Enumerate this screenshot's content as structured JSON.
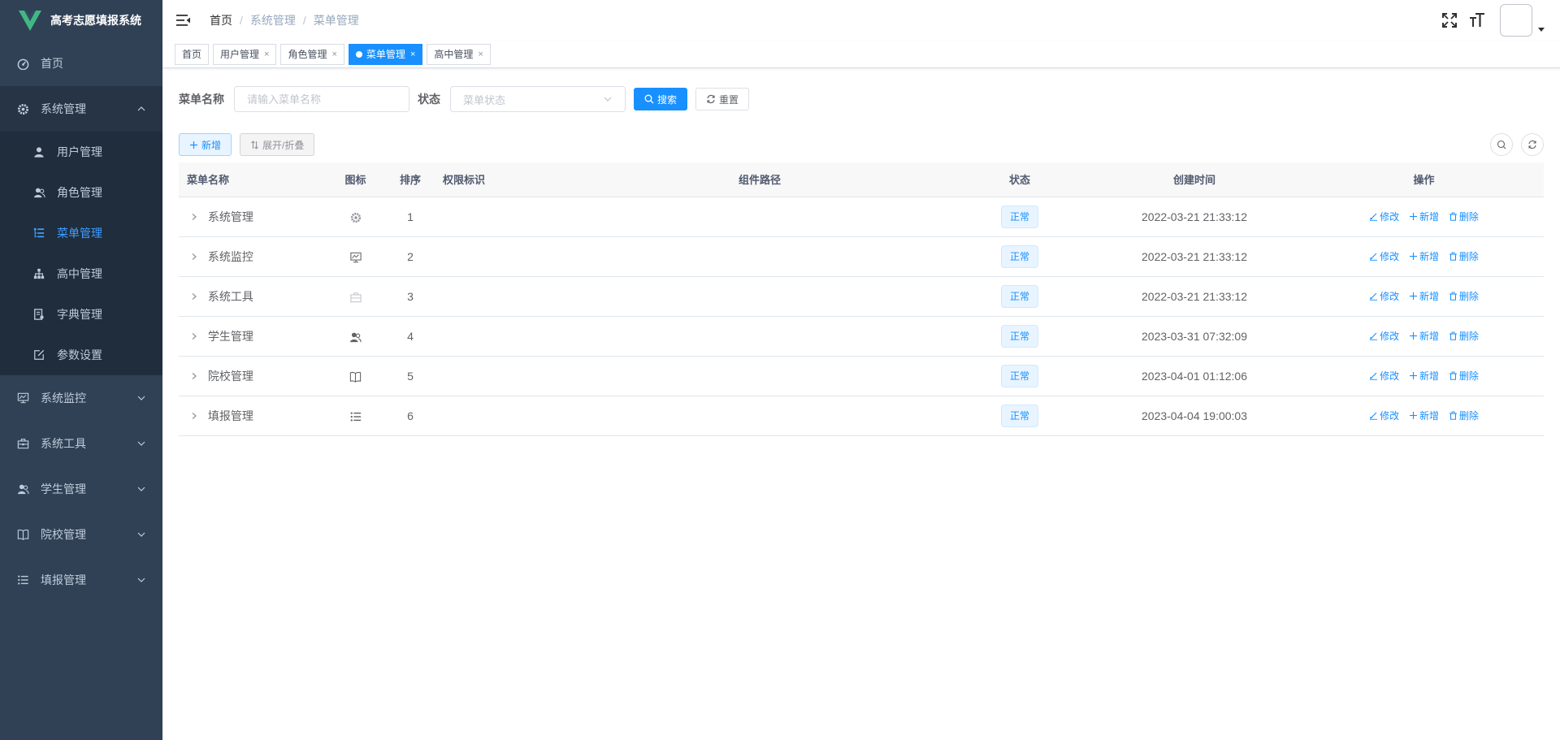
{
  "app": {
    "title": "高考志愿填报系统",
    "brand_color": "#41b883"
  },
  "sidebar": {
    "items": [
      {
        "label": "首页",
        "icon": "dashboard-icon"
      },
      {
        "label": "系统管理",
        "icon": "gear-icon",
        "open": true,
        "children": [
          {
            "label": "用户管理",
            "icon": "user-icon"
          },
          {
            "label": "角色管理",
            "icon": "peoples-icon"
          },
          {
            "label": "菜单管理",
            "icon": "tree-table-icon",
            "active": true
          },
          {
            "label": "高中管理",
            "icon": "tree-icon"
          },
          {
            "label": "字典管理",
            "icon": "dict-icon"
          },
          {
            "label": "参数设置",
            "icon": "edit-icon"
          }
        ]
      },
      {
        "label": "系统监控",
        "icon": "monitor-icon"
      },
      {
        "label": "系统工具",
        "icon": "tool-icon"
      },
      {
        "label": "学生管理",
        "icon": "peoples-icon"
      },
      {
        "label": "院校管理",
        "icon": "book-icon"
      },
      {
        "label": "填报管理",
        "icon": "list-icon"
      }
    ]
  },
  "breadcrumb": [
    "首页",
    "系统管理",
    "菜单管理"
  ],
  "tags": [
    {
      "label": "首页",
      "closable": false
    },
    {
      "label": "用户管理",
      "closable": true
    },
    {
      "label": "角色管理",
      "closable": true
    },
    {
      "label": "菜单管理",
      "closable": true,
      "active": true
    },
    {
      "label": "高中管理",
      "closable": true
    }
  ],
  "search": {
    "name_label": "菜单名称",
    "name_placeholder": "请输入菜单名称",
    "status_label": "状态",
    "status_placeholder": "菜单状态",
    "search_btn": "搜索",
    "reset_btn": "重置"
  },
  "toolbar": {
    "add_btn": "新增",
    "expand_btn": "展开/折叠"
  },
  "table": {
    "columns": [
      "菜单名称",
      "图标",
      "排序",
      "权限标识",
      "组件路径",
      "状态",
      "创建时间",
      "操作"
    ],
    "rows": [
      {
        "name": "系统管理",
        "icon": "gear-icon",
        "order": "1",
        "perm": "",
        "path": "",
        "status": "正常",
        "created": "2022-03-21 21:33:12"
      },
      {
        "name": "系统监控",
        "icon": "monitor-icon",
        "order": "2",
        "perm": "",
        "path": "",
        "status": "正常",
        "created": "2022-03-21 21:33:12"
      },
      {
        "name": "系统工具",
        "icon": "tool-icon",
        "order": "3",
        "perm": "",
        "path": "",
        "status": "正常",
        "created": "2022-03-21 21:33:12"
      },
      {
        "name": "学生管理",
        "icon": "peoples-icon",
        "order": "4",
        "perm": "",
        "path": "",
        "status": "正常",
        "created": "2023-03-31 07:32:09"
      },
      {
        "name": "院校管理",
        "icon": "book-icon",
        "order": "5",
        "perm": "",
        "path": "",
        "status": "正常",
        "created": "2023-04-01 01:12:06"
      },
      {
        "name": "填报管理",
        "icon": "list-icon",
        "order": "6",
        "perm": "",
        "path": "",
        "status": "正常",
        "created": "2023-04-04 19:00:03"
      }
    ],
    "actions": {
      "edit": "修改",
      "add": "新增",
      "delete": "删除"
    }
  }
}
